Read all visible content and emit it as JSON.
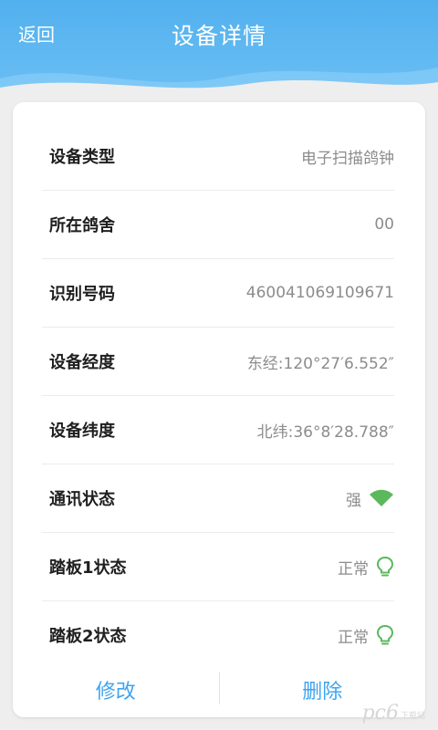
{
  "header": {
    "back_label": "返回",
    "title": "设备详情"
  },
  "details": [
    {
      "label": "设备类型",
      "value": "电子扫描鸽钟"
    },
    {
      "label": "所在鸽舍",
      "value": "00"
    },
    {
      "label": "识别号码",
      "value": "460041069109671"
    },
    {
      "label": "设备经度",
      "value": "东经:120°27′6.552″"
    },
    {
      "label": "设备纬度",
      "value": "北纬:36°8′28.788″"
    },
    {
      "label": "通讯状态",
      "value": "强",
      "icon": "wifi-icon"
    },
    {
      "label": "踏板1状态",
      "value": "正常",
      "icon": "lightbulb-icon"
    },
    {
      "label": "踏板2状态",
      "value": "正常",
      "icon": "lightbulb-icon"
    }
  ],
  "footer": {
    "edit_label": "修改",
    "delete_label": "删除"
  },
  "watermark": {
    "text": "pc6",
    "sub": "下载站"
  },
  "colors": {
    "accent": "#3fa4ee",
    "header": "#52b0ee",
    "status_green": "#5cb85c"
  }
}
